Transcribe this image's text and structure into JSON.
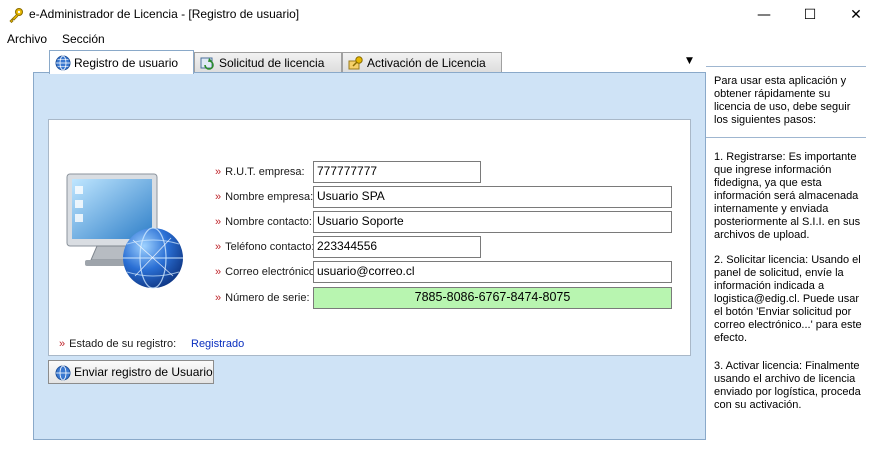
{
  "window": {
    "title": "e-Administrador de Licencia - [Registro de usuario]",
    "minimize": "—",
    "maximize": "☐",
    "close": "✕"
  },
  "menu": {
    "items": [
      "Archivo",
      "Sección"
    ]
  },
  "tabs": [
    {
      "label": "Registro de usuario",
      "icon": "globe-icon",
      "active": true
    },
    {
      "label": "Solicitud de licencia",
      "icon": "refresh-icon",
      "active": false
    },
    {
      "label": "Activación de Licencia",
      "icon": "key-icon",
      "active": false
    }
  ],
  "tab_dropdown": "▼",
  "form": {
    "chevron": "»",
    "fields": [
      {
        "label": "R.U.T. empresa:",
        "value": "777777777"
      },
      {
        "label": "Nombre empresa:",
        "value": "Usuario SPA"
      },
      {
        "label": "Nombre contacto:",
        "value": "Usuario Soporte"
      },
      {
        "label": "Teléfono contacto:",
        "value": "223344556"
      },
      {
        "label": "Correo electrónico:",
        "value": "usuario@correo.cl"
      },
      {
        "label": "Número de serie:",
        "value": "7885-8086-6767-8474-8075"
      }
    ],
    "status_label": "Estado de su registro:",
    "status_value": "Registrado",
    "send_button": "Enviar registro de Usuario"
  },
  "help": {
    "intro": "Para usar esta aplicación y obtener rápidamente su licencia de uso, debe seguir los siguientes pasos:",
    "step1": "1. Registrarse: Es importante que ingrese información fidedigna, ya que esta información será almacenada internamente y enviada posteriormente al S.I.I. en sus archivos de upload.",
    "step2": "2. Solicitar licencia: Usando el panel de solicitud, envíe la información indicada a logistica@edig.cl. Puede usar el botón 'Enviar solicitud por correo electrónico...' para este efecto.",
    "step3": "3. Activar licencia: Finalmente usando el archivo de licencia enviado por logística, proceda con su activación."
  },
  "colors": {
    "panel_bg": "#cfe3f6",
    "serial_bg": "#b8f5b0",
    "chevron": "#c0272d",
    "status_value": "#0a2fbf"
  }
}
